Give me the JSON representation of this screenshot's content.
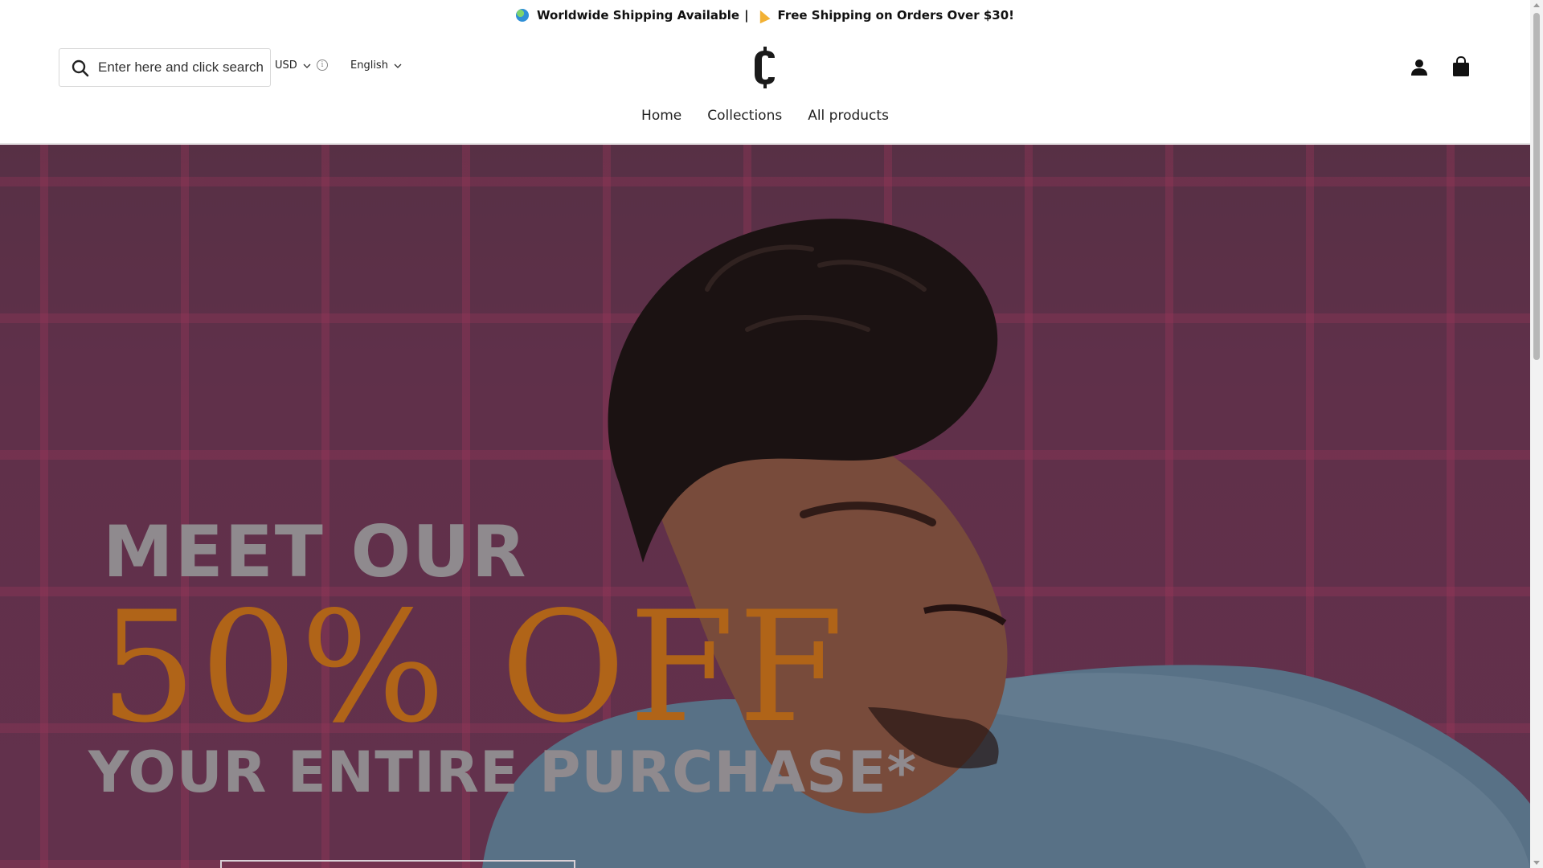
{
  "announcement": {
    "part1": "Worldwide Shipping Available",
    "separator": "|",
    "part2": "Free Shipping on Orders Over $30!"
  },
  "header": {
    "search_placeholder": "Enter here and click search",
    "currency": "USD",
    "language": "English",
    "logo_letter": "C"
  },
  "nav": {
    "items": [
      "Home",
      "Collections",
      "All products"
    ]
  },
  "hero": {
    "line1": "MEET OUR",
    "line2": "50% OFF",
    "line3": "YOUR ENTIRE PURCHASE*"
  },
  "icons": {
    "search": "search-icon",
    "account": "account-icon",
    "cart": "shopping-bag-icon",
    "info": "info-icon"
  },
  "colors": {
    "hero_bg": "#7a3d5d",
    "hero_accent": "#b06418",
    "hero_text": "#8f8a8e"
  }
}
